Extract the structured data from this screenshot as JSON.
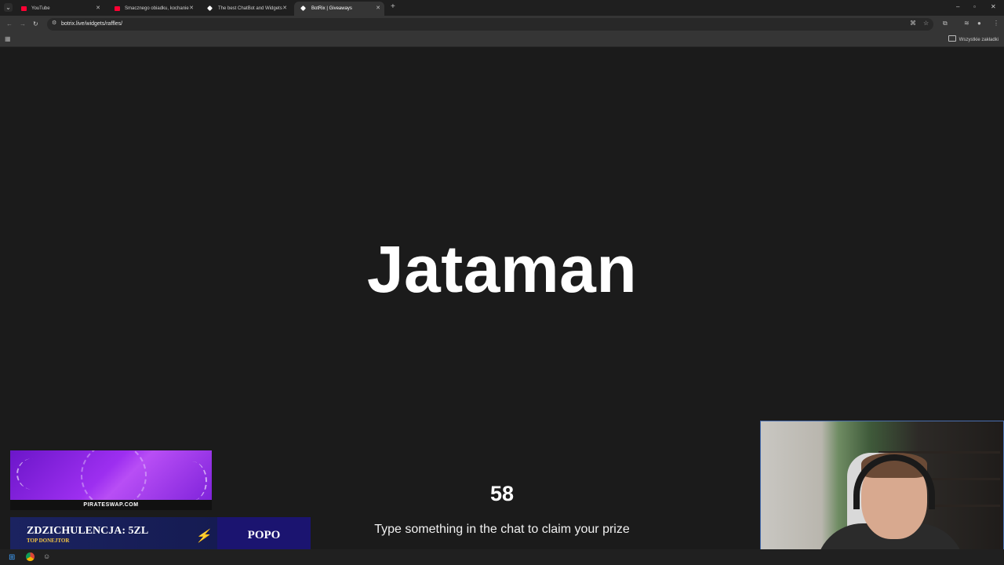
{
  "browser": {
    "tabs": [
      {
        "label": "YouTube",
        "color": "#ff0033",
        "active": false
      },
      {
        "label": "Smacznego obiadku, kochanie",
        "color": "#ff0033",
        "active": false
      },
      {
        "label": "The best ChatBot and Widgets",
        "color": "#ffffff",
        "active": false
      },
      {
        "label": "BotRix | Giveaways",
        "color": "#ffffff",
        "active": true
      }
    ],
    "url": "botrix.live/widgets/raffles/",
    "all_bookmarks_label": "Wszystkie zakładki"
  },
  "raffle": {
    "winner_name": "Jataman",
    "countdown": "58",
    "instruction": "Type something in the chat to claim your prize"
  },
  "overlay": {
    "sponsor_text": "PIRATESWAP.COM",
    "donor_title": "ZDZICHULENCJA: 5ZL",
    "donor_subtitle": "TOP DONEJTOR",
    "donor_right": "POPO"
  },
  "icons": {
    "tab_menu": "chevron-down-icon",
    "new_tab": "plus-icon",
    "back": "back-arrow-icon",
    "forward": "forward-arrow-icon",
    "reload": "reload-icon",
    "translate": "translate-icon",
    "bookmark_star": "star-icon",
    "extensions": "puzzle-icon",
    "profile": "profile-icon",
    "menu": "kebab-menu-icon"
  }
}
